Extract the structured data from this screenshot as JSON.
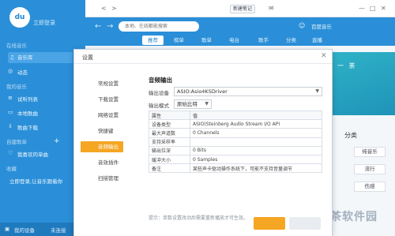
{
  "top_strip": {
    "nav_back": "<",
    "nav_forward": ">",
    "new_tab_label": "新建笔记",
    "mail_icon": "✉",
    "window_controls": [
      "—",
      "□",
      "✕"
    ]
  },
  "sidebar": {
    "logo_text": "du",
    "login": "立即登录",
    "sections": [
      {
        "title": "在线音乐",
        "items": [
          {
            "label": "音乐库",
            "active": true
          },
          {
            "label": "动态"
          }
        ]
      },
      {
        "title": "我的音乐",
        "items": [
          {
            "label": "试听列表"
          },
          {
            "label": "本地歌曲"
          },
          {
            "label": "歌曲下载"
          }
        ]
      },
      {
        "title": "自建歌单",
        "items": [
          {
            "label": "我喜欢的单曲"
          }
        ]
      },
      {
        "title": "收藏",
        "items": [
          {
            "label": "立即登录,让音乐跟着你"
          }
        ]
      }
    ],
    "bottom": {
      "device": "我的设备",
      "status": "未连接"
    }
  },
  "header": {
    "search_placeholder": "本地、在线都能搜索",
    "user_label": "百度音乐",
    "tabs": [
      "推荐",
      "榜单",
      "歌单",
      "电台",
      "歌手",
      "分类",
      "直播"
    ],
    "active_tab": 0
  },
  "content": {
    "banner_text": "一 茶",
    "banner_sub": "",
    "category_title": "分类",
    "categories": [
      "纯音乐",
      "流行",
      "伤感"
    ],
    "watermark": "绿茶软件园"
  },
  "dialog": {
    "title": "设置",
    "close": "✕",
    "nav": [
      "常规设置",
      "下载设置",
      "网络设置",
      "快捷键",
      "音频输出",
      "音效插件",
      "扫描管理"
    ],
    "active_nav": 4,
    "section_title": "音频输出",
    "output_device_label": "输出设备",
    "output_device_value": "ASIO:Asio4KSDriver",
    "output_mode_label": "输出模式",
    "output_mode_value": "原始比特",
    "table": [
      {
        "k": "属性",
        "v": "值"
      },
      {
        "k": "设备类型",
        "v": "ASIO(Steinberg Audio Stream I/O API"
      },
      {
        "k": "最大声道数",
        "v": "0 Channels"
      },
      {
        "k": "支持采样率",
        "v": ""
      },
      {
        "k": "输出位深",
        "v": "0 Bits"
      },
      {
        "k": "缓冲大小",
        "v": "0 Samples"
      },
      {
        "k": "备注",
        "v": "某些声卡驱动操作系统下，可能不支持音量调节"
      }
    ],
    "hint": "提示：单数设置改动后需要重新播放才可生效。"
  }
}
